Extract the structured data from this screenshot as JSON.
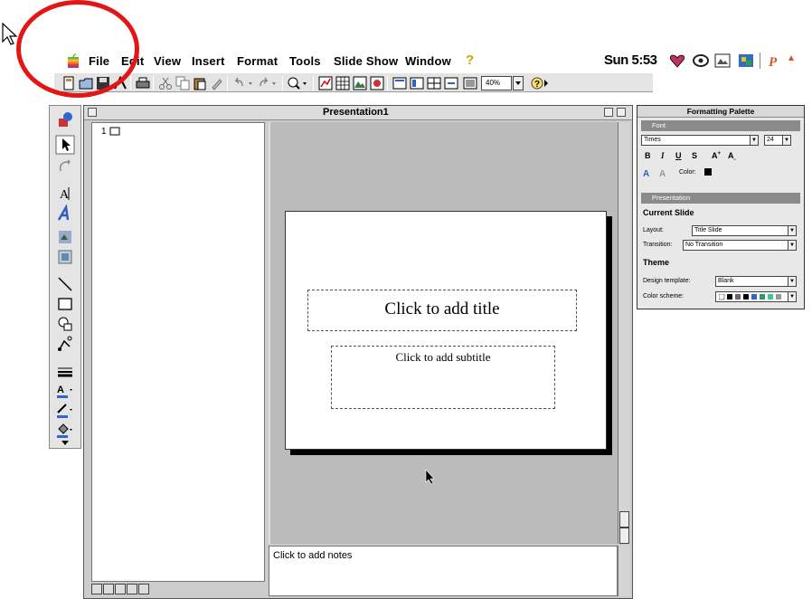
{
  "menu_bar": {
    "items": [
      "File",
      "Edit",
      "View",
      "Insert",
      "Format",
      "Tools",
      "Slide Show",
      "Window"
    ],
    "help_label": "?",
    "clock": "Sun 5:53"
  },
  "toolbar": {
    "zoom": "40%"
  },
  "window": {
    "title": "Presentation1"
  },
  "outline": {
    "slide_number": "1"
  },
  "slide": {
    "title_placeholder": "Click to add title",
    "subtitle_placeholder": "Click to add subtitle"
  },
  "notes": {
    "placeholder": "Click to add notes"
  },
  "palette": {
    "title": "Formatting Palette",
    "font_section": "Font",
    "font_name": "Times",
    "font_size": "24",
    "color_label": "Color:",
    "presentation_section": "Presentation",
    "current_slide_heading": "Current Slide",
    "layout_label": "Layout:",
    "layout_value": "Title Slide",
    "transition_label": "Transition:",
    "transition_value": "No Transition",
    "theme_heading": "Theme",
    "design_template_label": "Design template:",
    "design_template_value": "Blank",
    "color_scheme_label": "Color scheme:"
  },
  "colors": {
    "annotation_circle": "#e31515",
    "palette_section_bar": "#8a8a8a",
    "slide_area_bg": "#bbbbbb"
  }
}
